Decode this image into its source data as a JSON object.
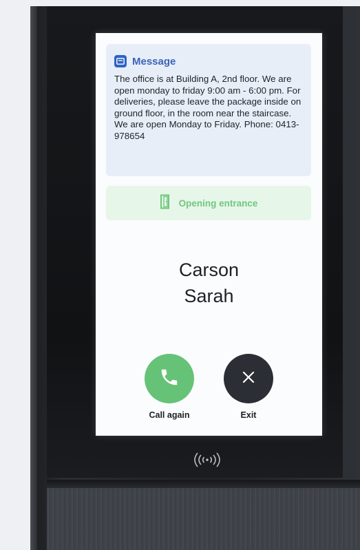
{
  "message": {
    "title": "Message",
    "body": "The office is at Building A, 2nd floor. We are open monday to friday 9:00 am - 6:00 pm. For deliveries, please leave the package inside on ground floor, in the room near the staircase. We are open Monday to Friday. Phone: 0413-978654",
    "icon": "message-icon"
  },
  "status": {
    "label": "Opening entrance",
    "icon": "door-icon"
  },
  "contact": {
    "line1": "Carson",
    "line2": "Sarah"
  },
  "actions": {
    "call_label": "Call again",
    "exit_label": "Exit"
  },
  "colors": {
    "accent_blue": "#3d62b8",
    "success_green": "#66c277",
    "status_bg": "#e6f6e8",
    "exit_dark": "#2b2f35"
  },
  "device": {
    "nfc_icon": "nfc-reader-icon"
  }
}
